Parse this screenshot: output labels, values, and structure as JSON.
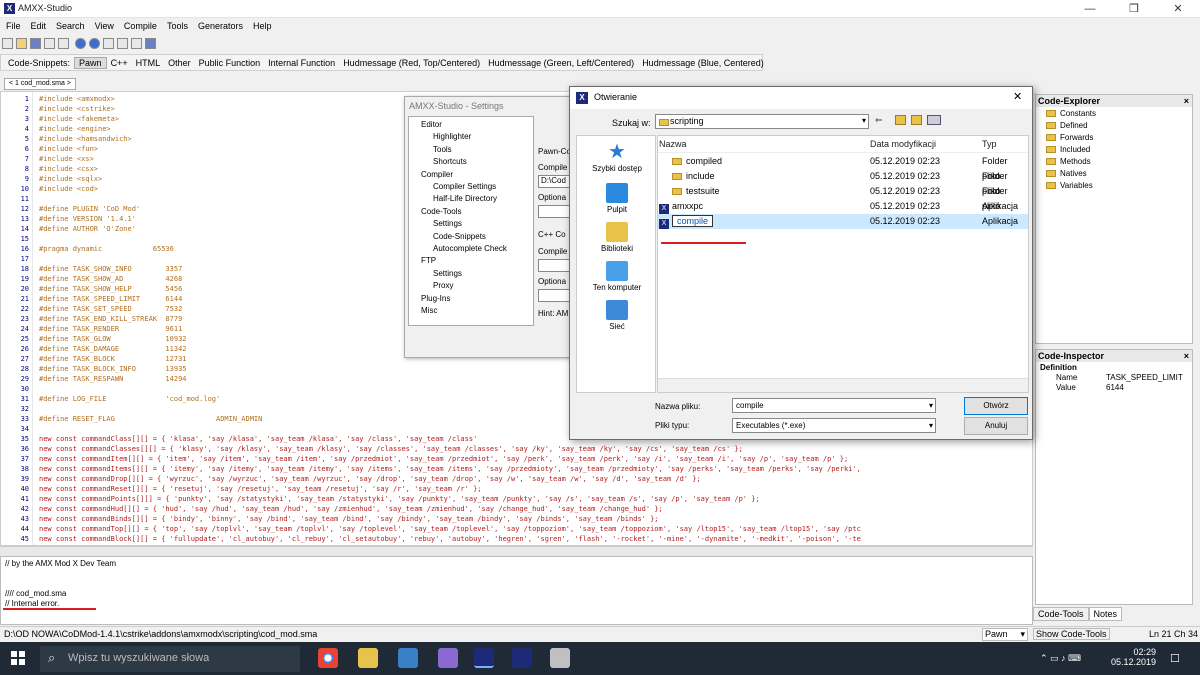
{
  "window": {
    "title": "AMXX-Studio",
    "controls": [
      "—",
      "❐",
      "✕"
    ]
  },
  "menu": [
    "File",
    "Edit",
    "Search",
    "View",
    "Compile",
    "Tools",
    "Generators",
    "Help"
  ],
  "snippets": {
    "label": "Code-Snippets:",
    "items": [
      "Pawn",
      "C++",
      "HTML",
      "Other",
      "Public Function",
      "Internal Function",
      "Hudmessage (Red, Top/Centered)",
      "Hudmessage (Green, Left/Centered)",
      "Hudmessage (Blue, Centered)"
    ],
    "active": "Pawn"
  },
  "editor_tab": "< 1 cod_mod.sma >",
  "code": [
    {
      "n": "1",
      "t": "#include <amxmodx>",
      "c": "dir"
    },
    {
      "n": "2",
      "t": "#include <cstrike>",
      "c": "dir"
    },
    {
      "n": "3",
      "t": "#include <fakemeta>",
      "c": "dir"
    },
    {
      "n": "4",
      "t": "#include <engine>",
      "c": "dir"
    },
    {
      "n": "5",
      "t": "#include <hamsandwich>",
      "c": "dir"
    },
    {
      "n": "6",
      "t": "#include <fun>",
      "c": "dir"
    },
    {
      "n": "7",
      "t": "#include <xs>",
      "c": "dir"
    },
    {
      "n": "8",
      "t": "#include <csx>",
      "c": "dir"
    },
    {
      "n": "9",
      "t": "#include <sqlx>",
      "c": "dir"
    },
    {
      "n": "10",
      "t": "#include <cod>",
      "c": "dir"
    },
    {
      "n": "11",
      "t": "",
      "c": "dir"
    },
    {
      "n": "12",
      "t": "#define PLUGIN 'CoD Mod'",
      "c": "dir"
    },
    {
      "n": "13",
      "t": "#define VERSION '1.4.1'",
      "c": "dir"
    },
    {
      "n": "14",
      "t": "#define AUTHOR 'O'Zone'",
      "c": "dir"
    },
    {
      "n": "15",
      "t": "",
      "c": "dir"
    },
    {
      "n": "16",
      "t": "#pragma dynamic            65536",
      "c": "dir"
    },
    {
      "n": "17",
      "t": "",
      "c": "dir"
    },
    {
      "n": "18",
      "t": "#define TASK_SHOW_INFO        3357",
      "c": "dir"
    },
    {
      "n": "19",
      "t": "#define TASK_SHOW_AD          4268",
      "c": "dir"
    },
    {
      "n": "20",
      "t": "#define TASK_SHOW_HELP        5456",
      "c": "dir"
    },
    {
      "n": "21",
      "t": "#define TASK_SPEED_LIMIT      6144",
      "c": "dir"
    },
    {
      "n": "22",
      "t": "#define TASK_SET_SPEED        7532",
      "c": "dir"
    },
    {
      "n": "23",
      "t": "#define TASK_END_KILL_STREAK  8779",
      "c": "dir"
    },
    {
      "n": "24",
      "t": "#define TASK_RENDER           9611",
      "c": "dir"
    },
    {
      "n": "25",
      "t": "#define TASK_GLOW             10932",
      "c": "dir"
    },
    {
      "n": "26",
      "t": "#define TASK_DAMAGE           11342",
      "c": "dir"
    },
    {
      "n": "27",
      "t": "#define TASK_BLOCK            12731",
      "c": "dir"
    },
    {
      "n": "28",
      "t": "#define TASK_BLOCK_INFO       13935",
      "c": "dir"
    },
    {
      "n": "29",
      "t": "#define TASK_RESPAWN          14294",
      "c": "dir"
    },
    {
      "n": "30",
      "t": "",
      "c": "dir"
    },
    {
      "n": "31",
      "t": "#define LOG_FILE              'cod_mod.log'",
      "c": "dir"
    },
    {
      "n": "32",
      "t": "",
      "c": "dir"
    },
    {
      "n": "33",
      "t": "#define RESET_FLAG                        ADMIN_ADMIN",
      "c": "dir"
    },
    {
      "n": "34",
      "t": "",
      "c": "dir"
    },
    {
      "n": "35",
      "t": "new const commandClass[][] = { 'klasa', 'say /klasa', 'say_team /klasa', 'say /class', 'say_team /class'",
      "c": "red"
    },
    {
      "n": "36",
      "t": "new const commandClasses[][] = { 'klasy', 'say /klasy', 'say_team /klasy', 'say /classes', 'say_team /classes', 'say /ky', 'say_team /ky', 'say /cs', 'say_team /cs' };",
      "c": "red"
    },
    {
      "n": "37",
      "t": "new const commandItem[][] = { 'item', 'say /item', 'say_team /item', 'say /przedmiot', 'say_team /przedmiot', 'say /perk', 'say_team /perk', 'say /i', 'say_team /i', 'say /p', 'say_team /p' };",
      "c": "red"
    },
    {
      "n": "38",
      "t": "new const commandItems[][] = { 'itemy', 'say /itemy', 'say_team /itemy', 'say /items', 'say_team /items', 'say /przedmioty', 'say_team /przedmioty', 'say /perks', 'say_team /perks', 'say /perki',",
      "c": "red"
    },
    {
      "n": "39",
      "t": "new const commandDrop[][] = { 'wyrzuc', 'say /wyrzuc', 'say_team /wyrzuc', 'say /drop', 'say_team /drop', 'say /w', 'say_team /w', 'say /d', 'say_team /d' };",
      "c": "red"
    },
    {
      "n": "40",
      "t": "new const commandReset[][] = { 'resetuj', 'say /resetuj', 'say_team /resetuj', 'say /r', 'say_team /r' };",
      "c": "red"
    },
    {
      "n": "41",
      "t": "new const commandPoints[][] = { 'punkty', 'say /statystyki', 'say_team /statystyki', 'say /punkty', 'say_team /punkty', 'say /s', 'say_team /s', 'say /p', 'say_team /p' };",
      "c": "red"
    },
    {
      "n": "42",
      "t": "new const commandHud[][] = { 'hud', 'say /hud', 'say_team /hud', 'say /zmienhud', 'say_team /zmienhud', 'say /change_hud', 'say_team /change_hud' };",
      "c": "red"
    },
    {
      "n": "43",
      "t": "new const commandBinds[][] = { 'bindy', 'binny', 'say /bind', 'say_team /bind', 'say /bindy', 'say_team /bindy', 'say /binds', 'say_team /binds' };",
      "c": "red"
    },
    {
      "n": "44",
      "t": "new const commandTop[][] = { 'top', 'say /toplvl', 'say_team /toplvl', 'say /toplevel', 'say_team /toplevel', 'say /toppoziom', 'say_team /toppoziom', 'say /ltop15', 'say_team /ltop15', 'say /ptc",
      "c": "red"
    },
    {
      "n": "45",
      "t": "new const commandBlock[][] = { 'fullupdate', 'cl_autobuy', 'cl_rebuy', 'cl_setautobuy', 'rebuy', 'autobuy', 'hegren', 'sgren', 'flash', '-rocket', '-mine', '-dynamite', '-medkit', '-poison', '-te",
      "c": "red"
    }
  ],
  "output": {
    "line1": "// by the AMX Mod X Dev Team",
    "line2": "//// cod_mod.sma",
    "line3": "// Internal error."
  },
  "status": {
    "path": "D:\\OD NOWA\\CoDMod-1.4.1\\cstrike\\addons\\amxmodx\\scripting\\cod_mod.sma",
    "lang": "Pawn",
    "show": "Show Code-Tools",
    "pos": "Ln 21 Ch 34"
  },
  "code_explorer": {
    "title": "Code-Explorer",
    "items": [
      "Constants",
      "Defined",
      "Forwards",
      "Included",
      "Methods",
      "Natives",
      "Variables"
    ]
  },
  "code_inspector": {
    "title": "Code-Inspector",
    "section": "Definition",
    "name_label": "Name",
    "name_value": "TASK_SPEED_LIMIT",
    "value_label": "Value",
    "value_value": "6144"
  },
  "right_tabs": [
    "Code-Tools",
    "Notes"
  ],
  "settings": {
    "title": "AMXX-Studio - Settings",
    "tree": [
      {
        "t": "Editor",
        "lvl": 0
      },
      {
        "t": "Highlighter",
        "lvl": 1
      },
      {
        "t": "Tools",
        "lvl": 1
      },
      {
        "t": "Shortcuts",
        "lvl": 1
      },
      {
        "t": "Compiler",
        "lvl": 0
      },
      {
        "t": "Compiler Settings",
        "lvl": 1
      },
      {
        "t": "Half-Life Directory",
        "lvl": 1
      },
      {
        "t": "Code-Tools",
        "lvl": 0
      },
      {
        "t": "Settings",
        "lvl": 1
      },
      {
        "t": "Code-Snippets",
        "lvl": 1
      },
      {
        "t": "Autocomplete Check",
        "lvl": 1
      },
      {
        "t": "FTP",
        "lvl": 0
      },
      {
        "t": "Settings",
        "lvl": 1
      },
      {
        "t": "Proxy",
        "lvl": 1
      },
      {
        "t": "Plug-Ins",
        "lvl": 0
      },
      {
        "t": "Misc",
        "lvl": 0
      }
    ],
    "right_labels": [
      "Pawn-Co",
      "Compile",
      "D:\\Cod",
      "Optiona",
      "C++ Co",
      "Compile",
      "Optiona",
      "Hint: AM"
    ]
  },
  "open_dialog": {
    "title": "Otwieranie",
    "lookin_label": "Szukaj w:",
    "lookin_value": "scripting",
    "places": [
      "Szybki dostęp",
      "Pulpit",
      "Biblioteki",
      "Ten komputer",
      "Sieć"
    ],
    "columns": [
      "Nazwa",
      "Data modyfikacji",
      "Typ"
    ],
    "files": [
      {
        "name": "compiled",
        "date": "05.12.2019 02:23",
        "type": "Folder plikó",
        "kind": "folder"
      },
      {
        "name": "include",
        "date": "05.12.2019 02:23",
        "type": "Folder plikó",
        "kind": "folder"
      },
      {
        "name": "testsuite",
        "date": "05.12.2019 02:23",
        "type": "Folder plikó",
        "kind": "folder"
      },
      {
        "name": "amxxpc",
        "date": "05.12.2019 02:23",
        "type": "Aplikacja",
        "kind": "app"
      },
      {
        "name": "compile",
        "date": "05.12.2019 02:23",
        "type": "Aplikacja",
        "kind": "app"
      }
    ],
    "filename_label": "Nazwa pliku:",
    "filename_value": "compile",
    "filetype_label": "Pliki typu:",
    "filetype_value": "Executables (*.exe)",
    "open_btn": "Otwórz",
    "cancel_btn": "Anuluj"
  },
  "taskbar": {
    "search": "Wpisz tu wyszukiwane słowa",
    "time": "02:29",
    "date": "05.12.2019"
  },
  "colors": {
    "directive": "#b07020",
    "string": "#b02020",
    "accent_red": "#d62020",
    "taskbar": "#1f2a36"
  }
}
